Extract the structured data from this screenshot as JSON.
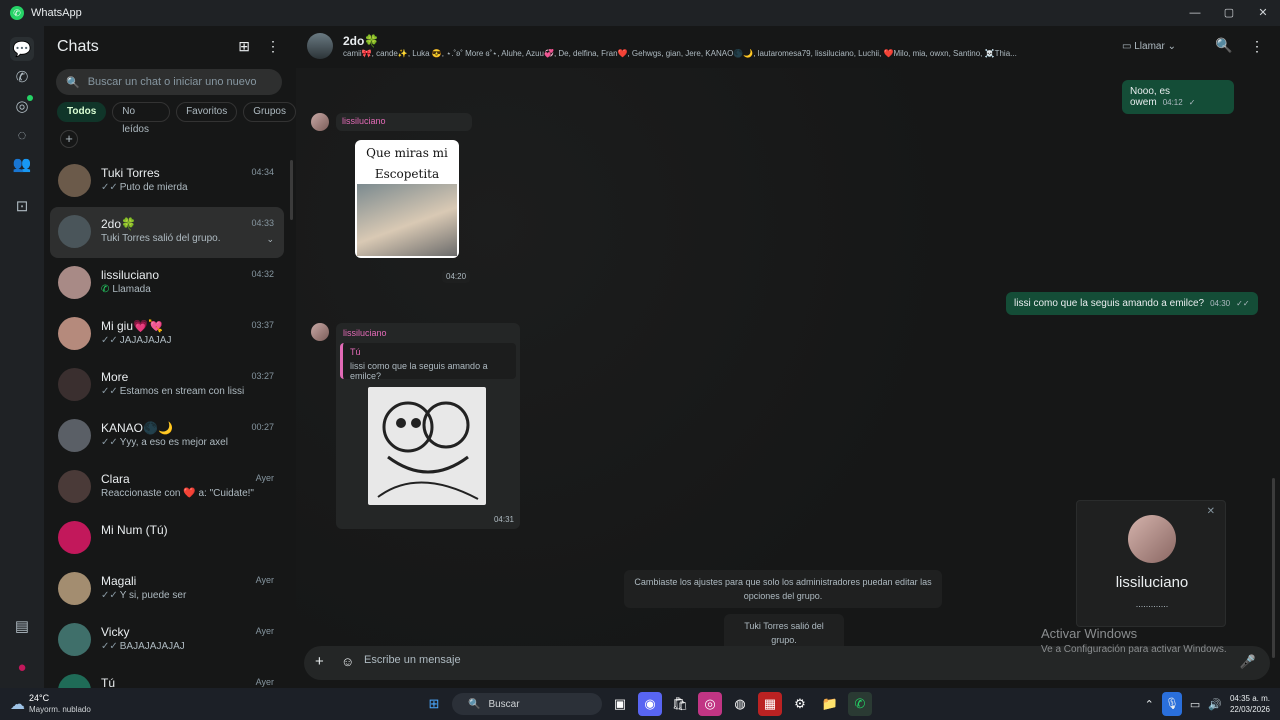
{
  "app": {
    "title": "WhatsApp",
    "window_controls": [
      "—",
      "▢",
      "✕"
    ]
  },
  "rail": {
    "items": [
      {
        "name": "chats-icon",
        "glyph": "💬"
      },
      {
        "name": "calls-icon",
        "glyph": "✆"
      },
      {
        "name": "status-icon",
        "glyph": "◎"
      },
      {
        "name": "channels-icon",
        "glyph": "◌"
      },
      {
        "name": "communities-icon",
        "glyph": "👥"
      },
      {
        "name": "archive-icon",
        "glyph": "⊡"
      }
    ],
    "bottom": [
      {
        "name": "media-icon",
        "glyph": "▤"
      },
      {
        "name": "profile-icon",
        "glyph": "●"
      }
    ]
  },
  "sidebar": {
    "title": "Chats",
    "search_placeholder": "Buscar un chat o iniciar uno nuevo",
    "filters": [
      "Todos",
      "No leídos",
      "Favoritos",
      "Grupos"
    ],
    "chats": [
      {
        "name": "Tuki Torres",
        "time": "04:34",
        "preview": "Puto de mierda",
        "tick": "✓✓",
        "av": "#6b5a4a"
      },
      {
        "name": "2do🍀",
        "time": "04:33",
        "preview": "Tuki Torres salió del grupo.",
        "tick": "",
        "av": "#4a555a",
        "selected": true
      },
      {
        "name": "lissiluciano",
        "time": "04:32",
        "preview": "Llamada",
        "tick": "phone",
        "av": "#a88a86"
      },
      {
        "name": "Mi giu💗💘",
        "time": "03:37",
        "preview": "JAJAJAJAJ",
        "tick": "✓✓",
        "av": "#b58a7c"
      },
      {
        "name": "More",
        "time": "03:27",
        "preview": "Estamos en stream con lissi",
        "tick": "✓✓",
        "av": "#3a2f2f"
      },
      {
        "name": "KANAO🌑🌙",
        "time": "00:27",
        "preview": "Yyy, a eso es mejor axel",
        "tick": "✓✓",
        "av": "#5a5f66"
      },
      {
        "name": "Clara",
        "time": "Ayer",
        "preview": "Reaccionaste con ❤️ a: \"Cuidate!\"",
        "tick": "",
        "av": "#4a3a38"
      },
      {
        "name": "Mi Num (Tú)",
        "time": "",
        "preview": "",
        "tick": "",
        "av": "#c2185b"
      },
      {
        "name": "Magali",
        "time": "Ayer",
        "preview": "Y si, puede ser",
        "tick": "✓✓",
        "av": "#a38d70"
      },
      {
        "name": "Vicky",
        "time": "Ayer",
        "preview": "BAJAJAJAJAJ",
        "tick": "✓✓",
        "av": "#3f6f6a"
      },
      {
        "name": "Tú",
        "time": "Ayer",
        "preview": "",
        "tick": "",
        "av": "#1f6b57"
      }
    ]
  },
  "chat": {
    "name": "2do🍀",
    "members": "camii🎀, cande✨, Luka 😎, ⋆.˚ʚ˚ More ɞ˚⋆, Aluhe, Azuu💞, De, delfina, Fran❤️, Gehwgs, gian, Jere, KANAO🌑🌙, lautaromesa79, lissiluciano, Luchii, ❤️Milo, mia, owxn, Santino, ☠️Thia...",
    "call_label": "Llamar",
    "messages": {
      "out1": {
        "text": "Nooo, es owem",
        "time": "04:12"
      },
      "in1": {
        "sender": "lissiluciano",
        "sticker_text": "Que miras mi Escopetita",
        "time": "04:20"
      },
      "out2": {
        "text": "lissi como que la seguis amando a emilce?",
        "time": "04:30"
      },
      "in2": {
        "sender": "lissiluciano",
        "quote_author": "Tú",
        "quote_text": "lissi como que la seguis amando a emilce?",
        "time": "04:31"
      },
      "sys1": "Cambiaste los ajustes para que solo los administradores puedan editar las opciones del grupo.",
      "sys2": "Tuki Torres salió del grupo."
    },
    "composer_placeholder": "Escribe un mensaje"
  },
  "call_popup": {
    "name": "lissiluciano",
    "status": "............."
  },
  "watermark": {
    "line1": "Activar Windows",
    "line2": "Ve a Configuración para activar Windows."
  },
  "taskbar": {
    "temp": "24°C",
    "weather": "Mayorm. nublado",
    "search_label": "Buscar",
    "time": "04:35 a. m.",
    "date": "22/03/2026"
  }
}
